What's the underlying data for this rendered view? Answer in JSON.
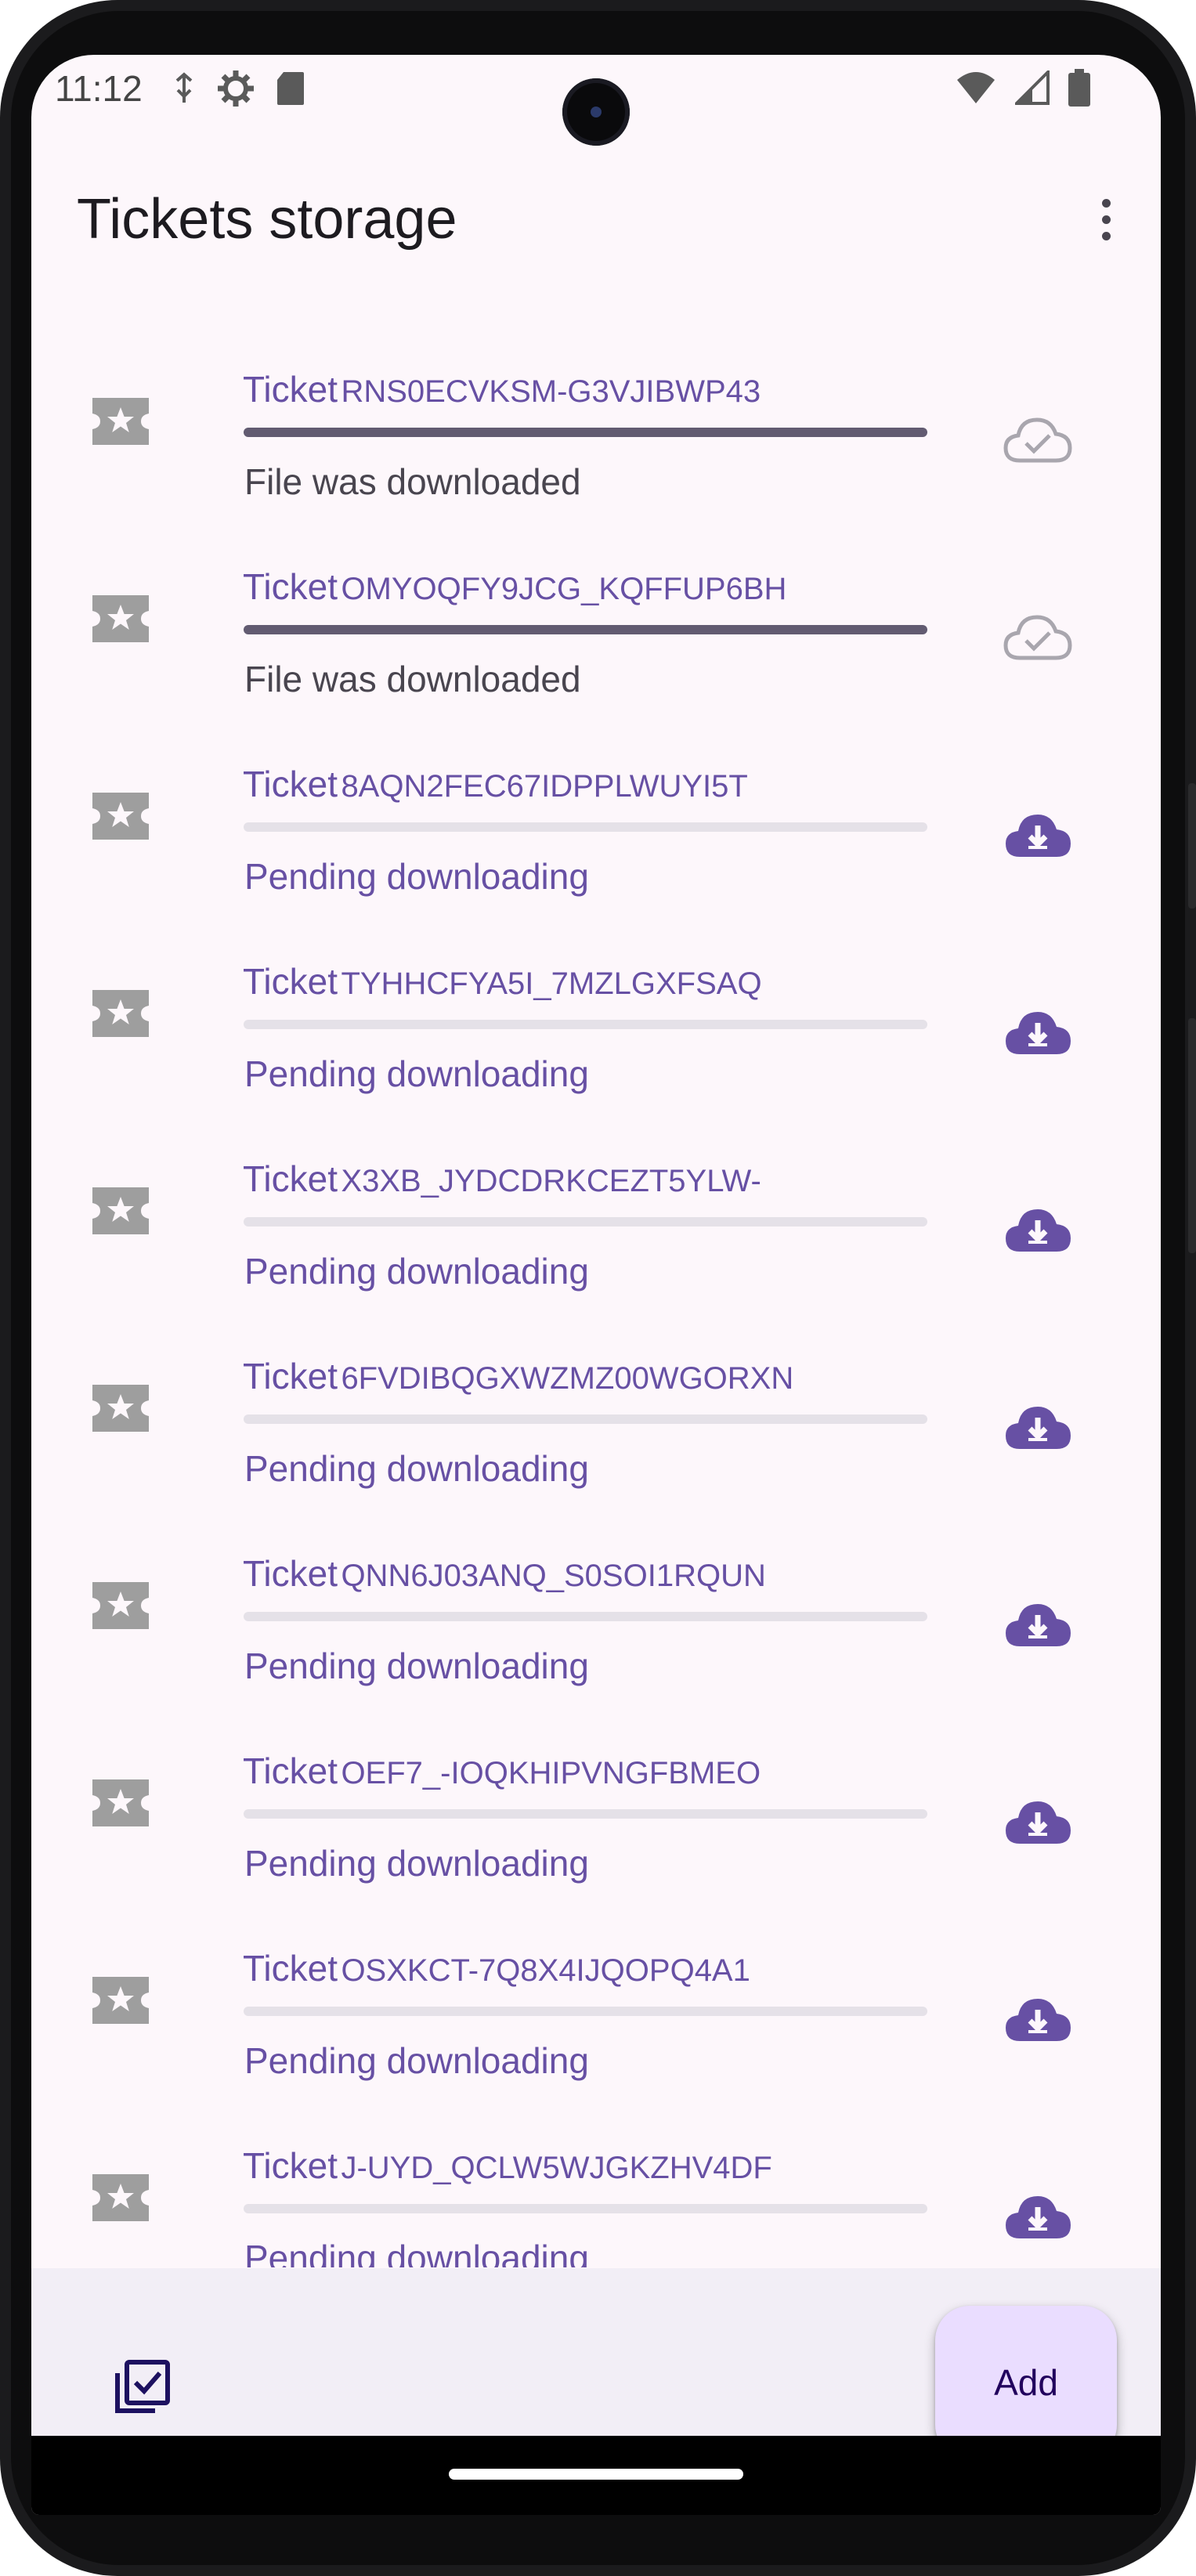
{
  "status_bar": {
    "time": "11:12",
    "left_icons": [
      "usb-debug-icon",
      "settings-icon",
      "sd-card-icon"
    ],
    "right_icons": [
      "wifi-icon",
      "signal-icon",
      "battery-icon"
    ]
  },
  "app_bar": {
    "title": "Tickets storage",
    "menu_icon": "more-vert-icon"
  },
  "colors": {
    "primary": "#6750a4",
    "progress_done": "#625b71",
    "track": "#e5e1e8",
    "icon_gray": "#9e9e9e",
    "fab_container": "#eaddff",
    "background": "#fdf7fb",
    "bottom_bar": "#f2eef6"
  },
  "tickets": [
    {
      "word": "Ticket",
      "code": "RNS0ECVKSM-G3VJIBWP43",
      "status": "File was downloaded",
      "state": "downloaded",
      "progress": 1.0,
      "action_icon": "cloud-done-icon"
    },
    {
      "word": "Ticket",
      "code": "OMYOQFY9JCG_KQFFUP6BH",
      "status": "File was downloaded",
      "state": "downloaded",
      "progress": 1.0,
      "action_icon": "cloud-done-icon"
    },
    {
      "word": "Ticket",
      "code": "8AQN2FEC67IDPPLWUYI5T",
      "status": "Pending downloading",
      "state": "pending",
      "progress": 0.0,
      "action_icon": "cloud-download-icon"
    },
    {
      "word": "Ticket",
      "code": "TYHHCFYA5I_7MZLGXFSAQ",
      "status": "Pending downloading",
      "state": "pending",
      "progress": 0.0,
      "action_icon": "cloud-download-icon"
    },
    {
      "word": "Ticket",
      "code": "X3XB_JYDCDRKCEZT5YLW-",
      "status": "Pending downloading",
      "state": "pending",
      "progress": 0.0,
      "action_icon": "cloud-download-icon"
    },
    {
      "word": "Ticket",
      "code": "6FVDIBQGXWZMZ00WGORXN",
      "status": "Pending downloading",
      "state": "pending",
      "progress": 0.0,
      "action_icon": "cloud-download-icon"
    },
    {
      "word": "Ticket",
      "code": "QNN6J03ANQ_S0SOI1RQUN",
      "status": "Pending downloading",
      "state": "pending",
      "progress": 0.0,
      "action_icon": "cloud-download-icon"
    },
    {
      "word": "Ticket",
      "code": "OEF7_-IOQKHIPVNGFBMEO",
      "status": "Pending downloading",
      "state": "pending",
      "progress": 0.0,
      "action_icon": "cloud-download-icon"
    },
    {
      "word": "Ticket",
      "code": "OSXKCT-7Q8X4IJQOPQ4A1",
      "status": "Pending downloading",
      "state": "pending",
      "progress": 0.0,
      "action_icon": "cloud-download-icon"
    },
    {
      "word": "Ticket",
      "code": "J-UYD_QCLW5WJGKZHV4DF",
      "status": "Pending downloading",
      "state": "pending",
      "progress": 0.0,
      "action_icon": "cloud-download-icon"
    }
  ],
  "bottom_bar": {
    "select_icon": "library-add-check-icon",
    "fab_label": "Add"
  }
}
